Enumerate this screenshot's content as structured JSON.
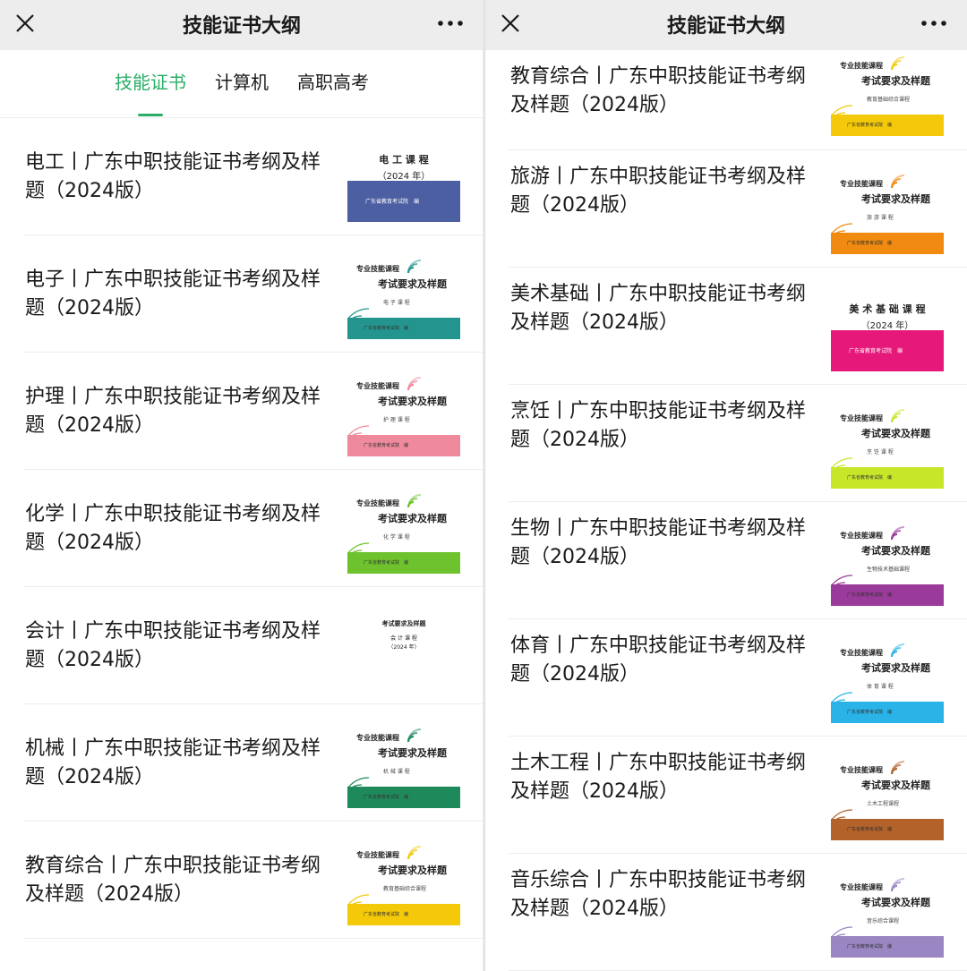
{
  "nav": {
    "title": "技能证书大纲"
  },
  "tabs": [
    {
      "label": "技能证书",
      "active": true
    },
    {
      "label": "计算机",
      "active": false
    },
    {
      "label": "高职高考",
      "active": false
    }
  ],
  "covers": {
    "header_label": "专业技能课程",
    "main_title": "考试要求及样题",
    "year": "（2024 年）",
    "publisher": "广东省教育考试院　编"
  },
  "left_list": [
    {
      "title": "电工丨广东中职技能证书考纲及样题（2024版）",
      "cover": "simple",
      "cover_title": "电 工 课 程",
      "color": "#4d5fa3"
    },
    {
      "title": "电子丨广东中职技能证书考纲及样题（2024版）",
      "cover": "standard",
      "cover_sub": "电 子 课 程",
      "color": "#24958e"
    },
    {
      "title": "护理丨广东中职技能证书考纲及样题（2024版）",
      "cover": "standard",
      "cover_sub": "护 理 课 程",
      "color": "#ee8a9b"
    },
    {
      "title": "化学丨广东中职技能证书考纲及样题（2024版）",
      "cover": "standard",
      "cover_sub": "化 学 课 程",
      "color": "#6dc22d"
    },
    {
      "title": "会计丨广东中职技能证书考纲及样题（2024版）",
      "cover": "plain",
      "cover_sub": "会 计 课 程",
      "color": "#ffffff"
    },
    {
      "title": "机械丨广东中职技能证书考纲及样题（2024版）",
      "cover": "standard",
      "cover_sub": "机 械 课 程",
      "color": "#1e8a5c"
    },
    {
      "title": "教育综合丨广东中职技能证书考纲及样题（2024版）",
      "cover": "standard",
      "cover_sub": "教育基础综合课程",
      "color": "#f3c90a"
    }
  ],
  "right_list": [
    {
      "title": "教育综合丨广东中职技能证书考纲及样题（2024版）",
      "cover": "standard",
      "cover_sub": "教育基础综合课程",
      "color": "#f3c90a"
    },
    {
      "title": "旅游丨广东中职技能证书考纲及样题（2024版）",
      "cover": "standard",
      "cover_sub": "旅 游 课 程",
      "color": "#f08a10"
    },
    {
      "title": "美术基础丨广东中职技能证书考纲及样题（2024版）",
      "cover": "simple",
      "cover_title": "美 术 基 础 课 程",
      "color": "#e6197b"
    },
    {
      "title": "烹饪丨广东中职技能证书考纲及样题（2024版）",
      "cover": "standard",
      "cover_sub": "烹 饪 课 程",
      "color": "#c8e629"
    },
    {
      "title": "生物丨广东中职技能证书考纲及样题（2024版）",
      "cover": "standard",
      "cover_sub": "生物技术基础课程",
      "color": "#9a3a9a"
    },
    {
      "title": "体育丨广东中职技能证书考纲及样题（2024版）",
      "cover": "standard",
      "cover_sub": "体 育 课 程",
      "color": "#2ab3e6"
    },
    {
      "title": "土木工程丨广东中职技能证书考纲及样题（2024版）",
      "cover": "standard",
      "cover_sub": "土木工程课程",
      "color": "#b3622a"
    },
    {
      "title": "音乐综合丨广东中职技能证书考纲及样题（2024版）",
      "cover": "standard",
      "cover_sub": "音乐综合课程",
      "color": "#9a86c2"
    }
  ]
}
